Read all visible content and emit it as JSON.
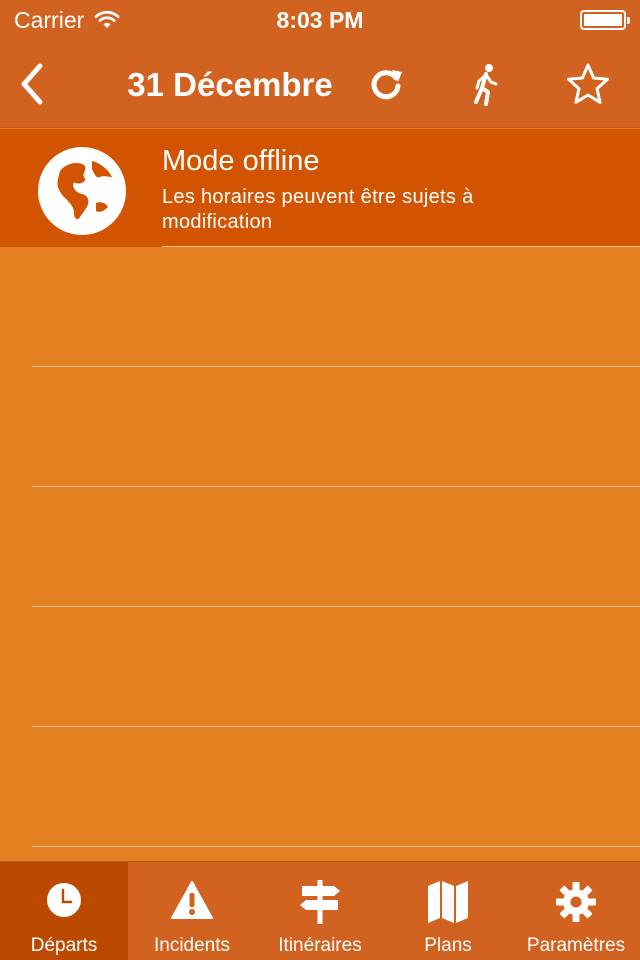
{
  "status_bar": {
    "carrier": "Carrier",
    "time": "8:03 PM",
    "wifi_icon": "wifi-icon",
    "battery_icon": "battery-icon"
  },
  "nav": {
    "title": "31 Décembre",
    "back_icon": "chevron-left-icon",
    "refresh_icon": "refresh-icon",
    "walk_icon": "walking-person-icon",
    "favorite_icon": "star-outline-icon"
  },
  "banner": {
    "icon": "globe-icon",
    "title": "Mode offline",
    "subtitle": "Les horaires peuvent être sujets à modification"
  },
  "rows": [
    "",
    "",
    "",
    "",
    ""
  ],
  "tabs": [
    {
      "label": "Départs",
      "icon": "clock-icon",
      "active": true
    },
    {
      "label": "Incidents",
      "icon": "warning-icon",
      "active": false
    },
    {
      "label": "Itinéraires",
      "icon": "signpost-icon",
      "active": false
    },
    {
      "label": "Plans",
      "icon": "map-icon",
      "active": false
    },
    {
      "label": "Paramètres",
      "icon": "gear-icon",
      "active": false
    }
  ],
  "colors": {
    "navbar": "#d2621f",
    "background": "#e67e22",
    "banner": "#d35400",
    "active_tab": "#bb4a00",
    "text": "#ffffff"
  }
}
